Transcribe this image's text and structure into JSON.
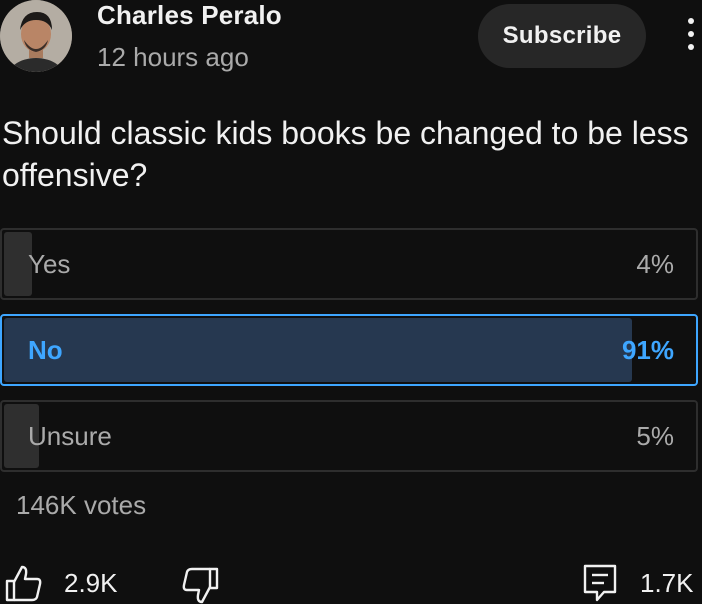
{
  "post": {
    "author": "Charles Peralo",
    "timestamp": "12 hours ago",
    "subscribe_label": "Subscribe",
    "more_icon": "more-vert-icon"
  },
  "poll": {
    "question": "Should classic kids books be changed to be less offensive?",
    "options": [
      {
        "label": "Yes",
        "percent": "4%",
        "fraction": 0.04,
        "selected": false
      },
      {
        "label": "No",
        "percent": "91%",
        "fraction": 0.91,
        "selected": true
      },
      {
        "label": "Unsure",
        "percent": "5%",
        "fraction": 0.05,
        "selected": false
      }
    ],
    "votes": "146K votes"
  },
  "actions": {
    "like_count": "2.9K",
    "comment_count": "1.7K",
    "like_icon": "thumbs-up-icon",
    "dislike_icon": "thumbs-down-icon",
    "comment_icon": "comment-icon"
  },
  "colors": {
    "background": "#0f0f0f",
    "accent": "#3ea6ff",
    "selected_fill": "#263850",
    "bar_fill": "#2f2f2f"
  }
}
